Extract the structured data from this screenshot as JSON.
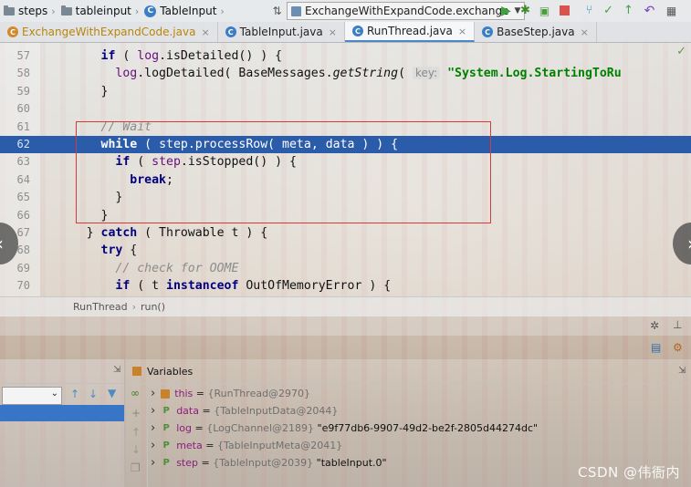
{
  "navbar": {
    "crumbs": [
      "steps",
      "tableinput",
      "TableInput"
    ],
    "run_config": "ExchangeWithExpandCode.exchange"
  },
  "tabs": [
    {
      "label": "ExchangeWithExpandCode.java",
      "active": false
    },
    {
      "label": "TableInput.java",
      "active": false
    },
    {
      "label": "RunThread.java",
      "active": true
    },
    {
      "label": "BaseStep.java",
      "active": false
    }
  ],
  "editor": {
    "lines": [
      {
        "n": "57",
        "parts": [
          {
            "t": "        "
          },
          {
            "t": "if",
            "c": "kw"
          },
          {
            "t": " ( "
          },
          {
            "t": "log",
            "c": "fld"
          },
          {
            "t": ".isDetailed() ) {"
          }
        ]
      },
      {
        "n": "58",
        "parts": [
          {
            "t": "          "
          },
          {
            "t": "log",
            "c": "fld"
          },
          {
            "t": ".logDetailed( BaseMessages."
          },
          {
            "t": "getString",
            "c": "it"
          },
          {
            "t": "( "
          },
          {
            "t": "key:",
            "c": "hint"
          },
          {
            "t": " "
          },
          {
            "t": "\"System.Log.StartingToRu",
            "c": "str"
          }
        ]
      },
      {
        "n": "59",
        "parts": [
          {
            "t": "        }"
          }
        ]
      },
      {
        "n": "60",
        "parts": [
          {
            "t": ""
          }
        ]
      },
      {
        "n": "61",
        "parts": [
          {
            "t": "        "
          },
          {
            "t": "// Wait",
            "c": "cm"
          }
        ]
      },
      {
        "n": "62",
        "parts": [
          {
            "t": "        "
          },
          {
            "t": "while",
            "c": "kw"
          },
          {
            "t": " ( "
          },
          {
            "t": "step",
            "c": "fld"
          },
          {
            "t": ".processRow( "
          },
          {
            "t": "meta",
            "c": "fld"
          },
          {
            "t": ", "
          },
          {
            "t": "data",
            "c": "fld"
          },
          {
            "t": " ) ) {"
          }
        ],
        "highlight": true
      },
      {
        "n": "63",
        "parts": [
          {
            "t": "          "
          },
          {
            "t": "if",
            "c": "kw"
          },
          {
            "t": " ( "
          },
          {
            "t": "step",
            "c": "fld"
          },
          {
            "t": ".isStopped() ) {"
          }
        ]
      },
      {
        "n": "64",
        "parts": [
          {
            "t": "            "
          },
          {
            "t": "break",
            "c": "kw"
          },
          {
            "t": ";"
          }
        ]
      },
      {
        "n": "65",
        "parts": [
          {
            "t": "          }"
          }
        ]
      },
      {
        "n": "66",
        "parts": [
          {
            "t": "        }"
          }
        ]
      },
      {
        "n": "67",
        "parts": [
          {
            "t": "      } "
          },
          {
            "t": "catch",
            "c": "kw"
          },
          {
            "t": " ( Throwable t ) {"
          }
        ]
      },
      {
        "n": "68",
        "parts": [
          {
            "t": "        "
          },
          {
            "t": "try",
            "c": "kw"
          },
          {
            "t": " {"
          }
        ]
      },
      {
        "n": "69",
        "parts": [
          {
            "t": "          "
          },
          {
            "t": "// check for OOME",
            "c": "cm"
          }
        ]
      },
      {
        "n": "70",
        "parts": [
          {
            "t": "          "
          },
          {
            "t": "if",
            "c": "kw"
          },
          {
            "t": " ( t "
          },
          {
            "t": "instanceof",
            "c": "kw"
          },
          {
            "t": " OutOfMemoryError ) {"
          }
        ]
      }
    ]
  },
  "editor_breadcrumb": [
    "RunThread",
    "run()"
  ],
  "variables": {
    "title": "Variables",
    "items": [
      {
        "name": "this",
        "eq": " = ",
        "type": "{RunThread@2970}",
        "value": "",
        "icon": "field"
      },
      {
        "name": "data",
        "eq": " = ",
        "type": "{TableInputData@2044}",
        "value": "",
        "icon": "param"
      },
      {
        "name": "log",
        "eq": " = ",
        "type": "{LogChannel@2189}",
        "value": " \"e9f77db6-9907-49d2-be2f-2805d44274dc\"",
        "icon": "param"
      },
      {
        "name": "meta",
        "eq": " = ",
        "type": "{TableInputMeta@2041}",
        "value": "",
        "icon": "param"
      },
      {
        "name": "step",
        "eq": " = ",
        "type": "{TableInput@2039}",
        "value": " \"tableInput.0\"",
        "icon": "param"
      }
    ]
  },
  "watermark": "CSDN @伟衙内"
}
